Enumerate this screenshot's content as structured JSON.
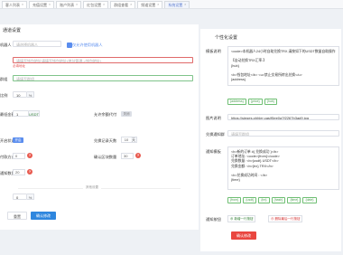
{
  "tabs": [
    "客人列表",
    "充值设置",
    "账户列表",
    "红包设置",
    "群组查看",
    "频道设置",
    "系统设置"
  ],
  "left": {
    "title": "通道设置",
    "robot_label": "机器人",
    "robot_placeholder": "请选择机器人",
    "robot_check_label": "仅允许使用机器人",
    "address_label": "地址",
    "address_placeholder": "请填写钱包地址请填写钱包地址(地址管理->钱包地址)",
    "address_error": "必填地址",
    "group_label": "群组",
    "group_placeholder": "请填写群组",
    "rate_label": "比例",
    "rate_value": "10",
    "rate_unit": "%",
    "min_label": "最低金额",
    "min_value": "1",
    "min_unit": "USDT",
    "allow_label": "允许余额代付",
    "allow_state": "关闭",
    "enable_label": "开启状态",
    "enable_state": "开启",
    "order_label": "兑换记录天数",
    "order_value": "10",
    "order_unit": "天",
    "type_label": "付款方式",
    "type_value": "0",
    "confirm_label": "确认区块数量",
    "confirm_value": "30",
    "count_label": "通知数量",
    "count_value": "20",
    "pct_value": "0",
    "pct_unit": "%",
    "divider_label": "其他设置",
    "reset_label": "重置",
    "submit_label": "确认修改"
  },
  "right": {
    "title": "个性化设置",
    "tpl_label": "模板说明",
    "tpl_lines": [
      "<code>本机器人24小时自助兑换TRX,请按如下的USDT数量自助操作",
      "",
      "【自动兑换TRX汇率:】",
      "{hub}",
      "",
      "<b>钱包地址</b> <u>禁止交易所转出兑换</u>",
      "{address}"
    ],
    "tpl_tags": [
      "{address}",
      "{price}",
      "{hub}"
    ],
    "img_label": "图片说明",
    "img_value": "https://sieges.phhler.cas/f5ee0a7f2267b3ad9.jpg",
    "group_link_label": "兑换通知群",
    "group_link_placeholder": "请填写群组",
    "notify_tpl_label": "通知模板",
    "notify_lines": [
      "<b>新的订单 #{ 兑换成功 }</b>",
      "订单地址: <code>{from}</code>",
      "兑换数量: <b>{usdt} USDT</b>",
      "兑换金额: <b>{trx} TRX</b>",
      "",
      "<b>兑换成功时间 : </b>",
      "{time}"
    ],
    "notify_tags": [
      "{from}",
      "{usdt}",
      "{trx}",
      "{hash}",
      "{time}",
      "{date}"
    ],
    "btn_label": "通知按钮",
    "add_btn_label": "新增一行按钮",
    "del_btn_label": "删除最后一行按钮",
    "submit_label": "确认修改"
  }
}
